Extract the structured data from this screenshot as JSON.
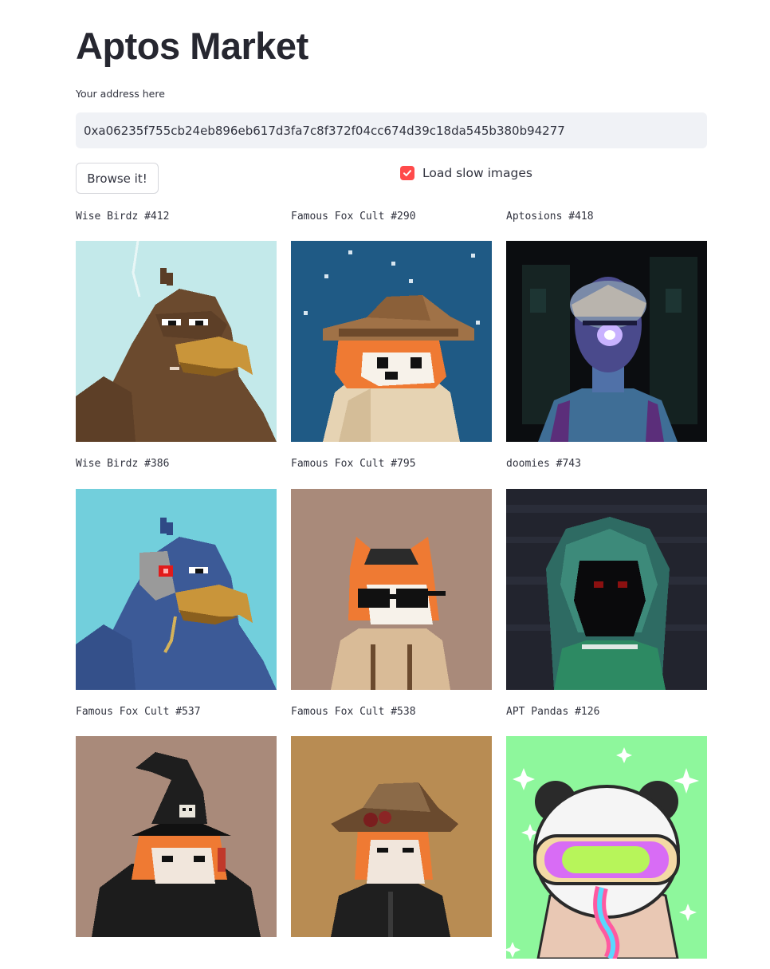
{
  "app": {
    "title": "Aptos Market"
  },
  "address": {
    "label": "Your address here",
    "value": "0xa06235f755cb24eb896eb617d3fa7c8f372f04cc674d39c18da545b380b94277"
  },
  "actions": {
    "browse_label": "Browse it!",
    "load_slow_images_label": "Load slow images",
    "load_slow_images_checked": true
  },
  "accent_color": "#ff4b4b",
  "gallery": {
    "items": [
      {
        "title": "Wise Birdz #412",
        "bg": "#c3e9ea",
        "art": "bird-brown"
      },
      {
        "title": "Famous Fox Cult #290",
        "bg": "#1f5a85",
        "art": "fox-hat-night"
      },
      {
        "title": "Aptosions #418",
        "bg": "#0b0d10",
        "art": "cyborg"
      },
      {
        "title": "Wise Birdz #386",
        "bg": "#72cfdc",
        "art": "bird-blue"
      },
      {
        "title": "Famous Fox Cult #795",
        "bg": "#a98a7a",
        "art": "fox-shades"
      },
      {
        "title": "doomies #743",
        "bg": "#22242e",
        "art": "hooded"
      },
      {
        "title": "Famous Fox Cult #537",
        "bg": "#a98a7a",
        "art": "fox-witch"
      },
      {
        "title": "Famous Fox Cult #538",
        "bg": "#b88c53",
        "art": "fox-cowboy"
      },
      {
        "title": "APT Pandas #126",
        "bg": "#8ef79c",
        "art": "panda"
      }
    ]
  }
}
